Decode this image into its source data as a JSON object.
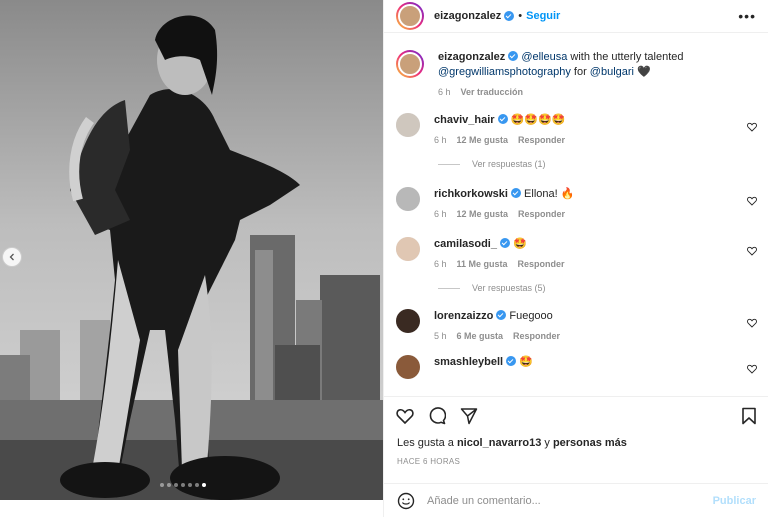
{
  "post": {
    "username": "eizagonzalez",
    "follow_label": "Seguir",
    "more_label": "•••"
  },
  "caption": {
    "username": "eizagonzalez",
    "mention1": "@elleusa",
    "text1": " with the utterly talented ",
    "mention2": "@gregwilliamsphotography",
    "text2": " for ",
    "mention3": "@bulgari",
    "emoji": " 🖤",
    "time": "6 h",
    "translate_label": "Ver traducción"
  },
  "comments": [
    {
      "user": "chaviv_hair",
      "verified": true,
      "text": "🤩🤩🤩🤩",
      "time": "6 h",
      "likes": "12 Me gusta",
      "reply": "Responder",
      "replies": "Ver respuestas (1)"
    },
    {
      "user": "richkorkowski",
      "verified": true,
      "text": "Ellona! 🔥",
      "time": "6 h",
      "likes": "12 Me gusta",
      "reply": "Responder",
      "replies": ""
    },
    {
      "user": "camilasodi_",
      "verified": true,
      "text": "🤩",
      "time": "6 h",
      "likes": "11 Me gusta",
      "reply": "Responder",
      "replies": "Ver respuestas (5)"
    },
    {
      "user": "lorenzaizzo",
      "verified": true,
      "text": "Fuegooo",
      "time": "5 h",
      "likes": "6 Me gusta",
      "reply": "Responder",
      "replies": ""
    },
    {
      "user": "smashleybell",
      "verified": true,
      "text": "🤩",
      "time": "",
      "likes": "",
      "reply": "",
      "replies": ""
    }
  ],
  "likes": {
    "prefix": "Les gusta a ",
    "user": "nicol_navarro13",
    "mid": " y ",
    "rest": "personas más"
  },
  "time_ago": "HACE 6 HORAS",
  "add_comment": {
    "placeholder": "Añade un comentario...",
    "post_label": "Publicar"
  },
  "colors": {
    "accent": "#0095f6",
    "verified": "#3897f0",
    "muted": "#8e8e8e"
  },
  "carousel": {
    "count": 7,
    "active_index": 6
  }
}
